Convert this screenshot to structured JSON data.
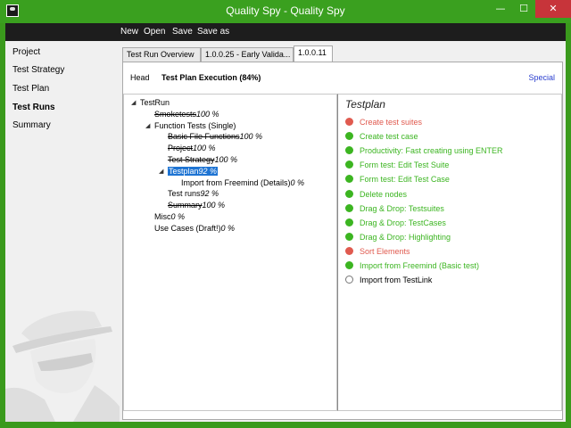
{
  "window": {
    "title": "Quality Spy - Quality Spy",
    "min": "—",
    "max": "☐",
    "close": "✕"
  },
  "menu": [
    "New",
    "Open",
    "Save",
    "Save as"
  ],
  "sidebar": [
    {
      "label": "Project",
      "active": false
    },
    {
      "label": "Test Strategy",
      "active": false
    },
    {
      "label": "Test Plan",
      "active": false
    },
    {
      "label": "Test Runs",
      "active": true
    },
    {
      "label": "Summary",
      "active": false
    }
  ],
  "tabs": [
    {
      "label": "Test Run Overview",
      "active": false
    },
    {
      "label": "1.0.0.25 - Early Valida...",
      "active": false
    },
    {
      "label": "1.0.0.11",
      "active": true
    }
  ],
  "header": {
    "head_label": "Head",
    "title": "Test Plan Execution (84%)",
    "special": "Special"
  },
  "tree": [
    {
      "label": "TestRun",
      "pct": "",
      "strike": false,
      "level": 0,
      "arrow": "◢"
    },
    {
      "label": "Smoketests",
      "pct": "100 %",
      "strike": true,
      "level": 1,
      "arrow": ""
    },
    {
      "label": "Function Tests (Single)",
      "pct": "",
      "strike": false,
      "level": 1,
      "arrow": "◢"
    },
    {
      "label": "Basic File Functions",
      "pct": "100 %",
      "strike": true,
      "level": 2,
      "arrow": ""
    },
    {
      "label": "Project",
      "pct": "100 %",
      "strike": true,
      "level": 2,
      "arrow": ""
    },
    {
      "label": "Test Strategy",
      "pct": "100 %",
      "strike": true,
      "level": 2,
      "arrow": ""
    },
    {
      "label": "Testplan",
      "pct": "92 %",
      "strike": false,
      "level": 2,
      "arrow": "◢",
      "selected": true
    },
    {
      "label": "Import from Freemind (Details)",
      "pct": "0 %",
      "strike": false,
      "level": 3,
      "arrow": ""
    },
    {
      "label": "Test runs",
      "pct": "92 %",
      "strike": false,
      "level": 2,
      "arrow": ""
    },
    {
      "label": "Summary",
      "pct": "100 %",
      "strike": true,
      "level": 2,
      "arrow": ""
    },
    {
      "label": "Misc",
      "pct": "0 %",
      "strike": false,
      "level": 1,
      "arrow": ""
    },
    {
      "label": "Use Cases (Draft!)",
      "pct": "0 %",
      "strike": false,
      "level": 1,
      "arrow": ""
    }
  ],
  "plan": {
    "title": "Testplan",
    "items": [
      {
        "label": "Create test suites",
        "status": "failed"
      },
      {
        "label": "Create test case",
        "status": "passed"
      },
      {
        "label": "Productivity: Fast creating using ENTER",
        "status": "passed"
      },
      {
        "label": "Form test: Edit Test Suite",
        "status": "passed"
      },
      {
        "label": "Form test: Edit Test Case",
        "status": "passed"
      },
      {
        "label": "Delete nodes",
        "status": "passed"
      },
      {
        "label": "Drag & Drop: Testsuites",
        "status": "passed"
      },
      {
        "label": "Drag & Drop: TestCases",
        "status": "passed"
      },
      {
        "label": "Drag & Drop: Highlighting",
        "status": "passed"
      },
      {
        "label": "Sort Elements",
        "status": "failed"
      },
      {
        "label": "Import from Freemind (Basic test)",
        "status": "passed"
      },
      {
        "label": "Import from TestLink",
        "status": "open"
      }
    ]
  },
  "colors": {
    "frame": "#3aa01f",
    "passed": "#3cb521",
    "failed": "#e05a4f",
    "open": "#ffffff",
    "selection": "#1e74d3",
    "link": "#2b3fcf"
  }
}
